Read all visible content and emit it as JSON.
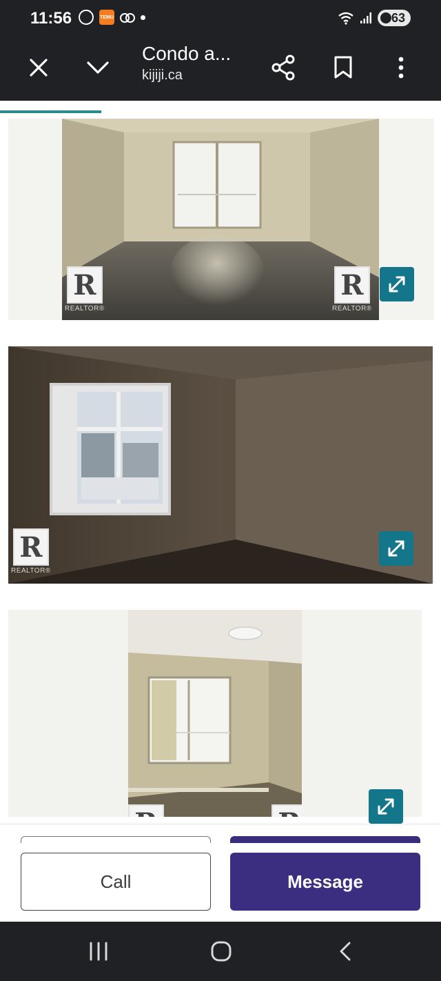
{
  "status_bar": {
    "time": "11:56",
    "left_icons": [
      "whatsapp-icon",
      "temu-icon",
      "voicemail-icon",
      "dot-icon"
    ],
    "temu_label": "TEMU",
    "right_icons": [
      "wifi-icon",
      "signal-icon",
      "battery-icon"
    ],
    "battery": "63"
  },
  "toolbar": {
    "title": "Condo a...",
    "url": "kijiji.ca",
    "icons": [
      "close-icon",
      "chevron-down-icon",
      "share-icon",
      "bookmark-icon",
      "more-vert-icon"
    ]
  },
  "load_progress": 0.23,
  "gallery": {
    "photos": [
      {
        "description_name": "living-room-photo",
        "watermark": "REALTOR®"
      },
      {
        "description_name": "bedroom-photo",
        "watermark": "REALTOR®"
      },
      {
        "description_name": "second-bedroom-photo",
        "watermark": "REALTOR®"
      }
    ],
    "realtor_letter": "R",
    "realtor_text": "REALTOR®",
    "expand_icon": "expand-icon"
  },
  "actions": {
    "call_label": "Call",
    "message_label": "Message"
  },
  "colors": {
    "toolbar_bg": "#202124",
    "accent_teal": "#2b8a8c",
    "expand_bg": "#14768a",
    "message_bg": "#3b2d80"
  },
  "nav_bar": {
    "icons": [
      "recents-icon",
      "home-icon",
      "back-icon"
    ]
  }
}
